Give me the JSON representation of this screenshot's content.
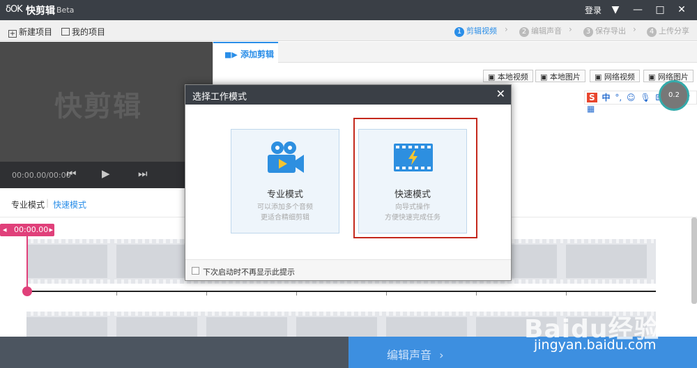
{
  "titlebar": {
    "logo": "δOK",
    "app_name": "快剪辑",
    "beta": "Beta",
    "login": "登录"
  },
  "toolbar": {
    "new_project": "新建项目",
    "my_project": "我的项目",
    "steps": [
      {
        "num": "1",
        "label": "剪辑视频",
        "active": true
      },
      {
        "num": "2",
        "label": "编辑声音",
        "active": false
      },
      {
        "num": "3",
        "label": "保存导出",
        "active": false
      },
      {
        "num": "4",
        "label": "上传分享",
        "active": false
      }
    ]
  },
  "preview": {
    "watermark": "快剪辑",
    "time": "00:00.00/00:00"
  },
  "right_panel": {
    "tab_label": "添加剪辑",
    "buttons": [
      "本地视频",
      "本地图片",
      "网络视频",
      "网络图片"
    ]
  },
  "ime": {
    "brand": "S",
    "lang": "中",
    "punct": "°,"
  },
  "speed_widget": "0.2",
  "mode": {
    "pro": "专业模式",
    "fast": "快速模式"
  },
  "timeline": {
    "time_tag": "00:00.00"
  },
  "bottom": {
    "next_label": "编辑声音",
    "next_arrow": "›"
  },
  "dialog": {
    "title": "选择工作模式",
    "close": "✕",
    "cards": [
      {
        "title": "专业模式",
        "desc1": "可以添加多个音频",
        "desc2": "更适合精细剪辑"
      },
      {
        "title": "快速模式",
        "desc1": "向导式操作",
        "desc2": "方便快速完成任务"
      }
    ],
    "footer": "下次启动时不再显示此提示"
  },
  "baidu": {
    "logo": "Baidu经验",
    "url": "jingyan.baidu.com"
  },
  "colors": {
    "accent": "#2a8ee8",
    "titlebar": "#3a3f46",
    "playhead": "#e0407a",
    "highlight": "#c4281c",
    "bottom_right": "#3d8fe0"
  }
}
